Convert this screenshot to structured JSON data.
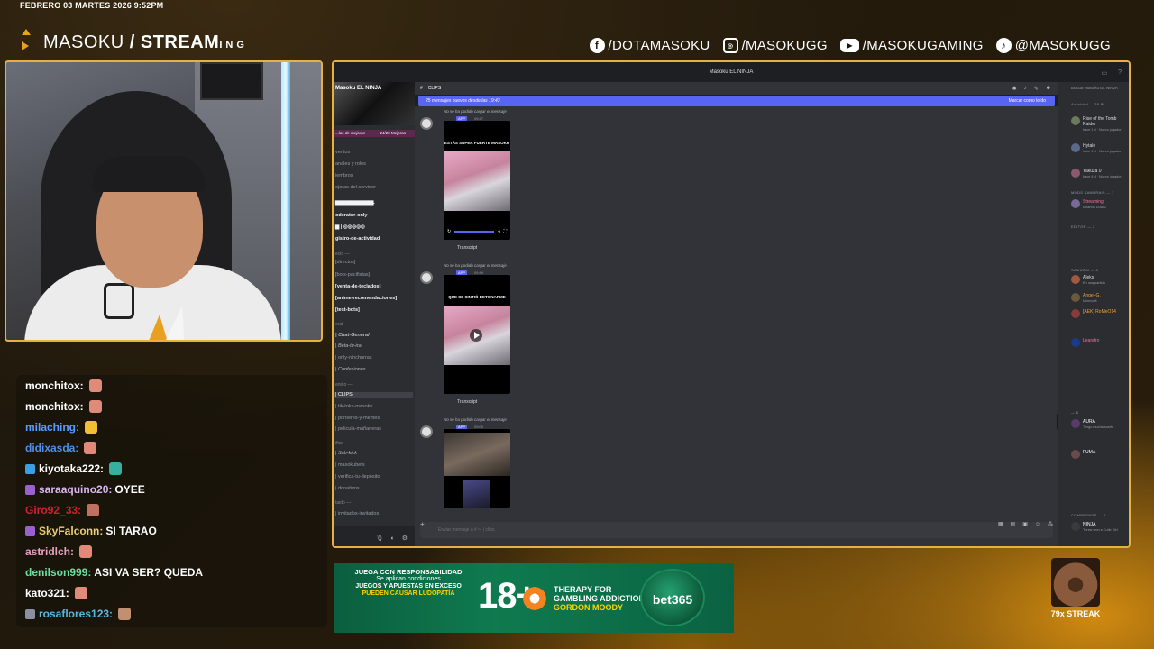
{
  "overlay": {
    "datetime": "FEBRERO 03 MARTES 2026 9:52PM",
    "logo_main": "MASOKU",
    "logo_slash": " / ",
    "logo_stream": "STREAM",
    "logo_small": "ING",
    "socials": [
      {
        "icon": "facebook-icon",
        "glyph": "f",
        "label": "/DOTAMASOKU"
      },
      {
        "icon": "instagram-icon",
        "glyph": "◎",
        "label": "/MASOKUGG"
      },
      {
        "icon": "youtube-icon",
        "glyph": "▶",
        "label": "/MASOKUGAMING"
      },
      {
        "icon": "tiktok-icon",
        "glyph": "♪",
        "label": "@MASOKUGG"
      }
    ],
    "accent": "#e8b040"
  },
  "chat": [
    {
      "user": "monchitox:",
      "color": "#ffffff",
      "msg": "",
      "emote": "#e08a7a",
      "badge": ""
    },
    {
      "user": "monchitox:",
      "color": "#ffffff",
      "msg": "",
      "emote": "#e08a7a",
      "badge": ""
    },
    {
      "user": "milaching:",
      "color": "#5b9bff",
      "msg": "",
      "emote": "#f0c030",
      "badge": ""
    },
    {
      "user": "didixasda:",
      "color": "#4f8fe8",
      "msg": "",
      "emote": "#e08a7a",
      "badge": ""
    },
    {
      "user": "kiyotaka222:",
      "color": "#ffffff",
      "msg": "",
      "emote": "#38b0a0",
      "badge": "#3aa0e0"
    },
    {
      "user": "saraaquino20:",
      "color": "#d9b8f0",
      "msg": "OYEE",
      "emote": "",
      "badge": "#9a60d0"
    },
    {
      "user": "Giro92_33:",
      "color": "#d02030",
      "msg": "",
      "emote": "#c07060",
      "badge": ""
    },
    {
      "user": "SkyFalconn:",
      "color": "#e8d070",
      "msg": "SI TARAO",
      "emote": "",
      "badge": "#9a60d0"
    },
    {
      "user": "astridlch:",
      "color": "#e8a0c0",
      "msg": "",
      "emote": "#e08a7a",
      "badge": ""
    },
    {
      "user": "denilson999:",
      "color": "#6ae0a0",
      "msg": "ASI VA SER? QUEDA",
      "emote": "",
      "badge": ""
    },
    {
      "user": "kato321:",
      "color": "#ffffff",
      "msg": "",
      "emote": "#e08a7a",
      "badge": ""
    },
    {
      "user": "rosaflores123:",
      "color": "#5ab8e0",
      "msg": "",
      "emote": "#c09070",
      "badge": "#8a90a0"
    }
  ],
  "discord": {
    "window_title": "Masoku EL NINJA",
    "server_name": "Masoku EL NINJA",
    "boost_left": "...las de mejoras",
    "boost_right": "24/20 Mejoras",
    "channels": [
      {
        "label": "ventos",
        "cls": ""
      },
      {
        "label": "anales y roles",
        "cls": ""
      },
      {
        "label": "iembros",
        "cls": ""
      },
      {
        "label": "ejoras del servidor",
        "cls": ""
      },
      {
        "label": "▆▆▆▆▆▆▆▆▆▆.",
        "cls": "bold"
      },
      {
        "label": "oderator-only",
        "cls": "bold"
      },
      {
        "label": "▆ | ◎◎◎◎◎",
        "cls": "bold"
      },
      {
        "label": "gistro-de-actividad",
        "cls": "bold"
      },
      {
        "label": "ecio —",
        "cls": "cat"
      },
      {
        "label": "[directos]",
        "cls": ""
      },
      {
        "label": "[bots-pacifistas]",
        "cls": ""
      },
      {
        "label": "[venta-de-teclados]",
        "cls": "bold"
      },
      {
        "label": "[anime-recomendaciones]",
        "cls": "bold"
      },
      {
        "label": "[test-bots]",
        "cls": "bold"
      },
      {
        "label": "eral —",
        "cls": "cat"
      },
      {
        "label": "| Chat-General",
        "cls": "bold ital"
      },
      {
        "label": "| Beta-tu-ira",
        "cls": "ital"
      },
      {
        "label": "| only-ninchurras",
        "cls": ""
      },
      {
        "label": "| Confesiones",
        "cls": "ital"
      },
      {
        "label": "enido —",
        "cls": "cat"
      },
      {
        "label": "| CLIPS",
        "cls": "active"
      },
      {
        "label": "| tik-toks-masoku",
        "cls": ""
      },
      {
        "label": "| poroeres-y-memes",
        "cls": ""
      },
      {
        "label": "| pelicula-mañaneras",
        "cls": ""
      },
      {
        "label": "ifica —",
        "cls": "cat"
      },
      {
        "label": "| Sub-kick",
        "cls": "ital"
      },
      {
        "label": "| masokubets",
        "cls": ""
      },
      {
        "label": "| verifica-tu-deposito",
        "cls": ""
      },
      {
        "label": "| donativos",
        "cls": ""
      },
      {
        "label": "taido —",
        "cls": "cat"
      },
      {
        "label": "| invitados-invitados",
        "cls": ""
      }
    ],
    "channel_header": "CLIPS",
    "new_messages": "25 mensajes nuevos desde las 19:43",
    "mark_read": "Marcar como leído",
    "messages": [
      {
        "reply": "No se ha podido cargar el mensaje",
        "app": "APP",
        "time": "09:47",
        "video_title": "ESTÁS SUPER FUERTE MASOKU",
        "transcript": "Transcript"
      },
      {
        "reply": "No se ha podido cargar el mensaje",
        "app": "APP",
        "time": "09:49",
        "video_title": "QUE SE SINTIÓ DETONARME",
        "transcript": "Transcript"
      },
      {
        "reply": "No se ha podido cargar el mensaje",
        "app": "APP",
        "time": "09:09",
        "video_title": "",
        "transcript": ""
      }
    ],
    "composer_placeholder": "Enviar mensaje a #  ✂ | clips",
    "member_search": "Buscar Masoku EL NINJA",
    "activity_label": "Actividad — 28 ⊕",
    "members": [
      {
        "name": "Rise of the Tomb Raider",
        "sub": "hace 1 d · Nuevo jugador",
        "color": "#dbdee1",
        "av": "#6a7a5a"
      },
      {
        "name": "Hytale",
        "sub": "hace 1 d · Nuevo jugador",
        "color": "#dbdee1",
        "av": "#5a6a8a"
      },
      {
        "name": "Yakuza 0",
        "sub": "hace 4 d · Nuevo jugador",
        "color": "#dbdee1",
        "av": "#8a5a6a"
      },
      {
        "name": "Streaming",
        "sub": "Mirando Dota 2",
        "color": "#ff6b9a",
        "av": "#7a6a9a"
      },
      {
        "name": "Aleks",
        "sub": "En una partida",
        "color": "#dbdee1",
        "av": "#a05a40"
      },
      {
        "name": "Angel-G.",
        "sub": "Minecraft",
        "color": "#f0a040",
        "av": "#6a5a3a"
      },
      {
        "name": "[AEK] RoMeO14",
        "sub": "",
        "color": "#f0a040",
        "av": "#8a3a3a"
      },
      {
        "name": "Leandro",
        "sub": "",
        "color": "#ff6b9a",
        "av": "#1a3a8a"
      },
      {
        "name": "AURA",
        "sub": "Tengo mucha suerte",
        "color": "#ffffff",
        "av": "#5a3a6a"
      },
      {
        "name": "FUMA",
        "sub": "",
        "color": "#ffffff",
        "av": "#6a4a4a"
      },
      {
        "name": "NINJA",
        "sub": "Threw won a Cutie Girl",
        "color": "#ffffff",
        "av": "#3a3a3a"
      }
    ],
    "member_cats": [
      "MODS SAMURAIS — 1",
      "EDITOR — 2",
      "SAMURAI — 6",
      "— 6",
      "COMPRENDE — 4"
    ]
  },
  "bet": {
    "l1": "JUEGA CON RESPONSABILIDAD",
    "l2": "Se aplican condiciones",
    "l3": "JUEGOS Y APUESTAS EN EXCESO",
    "l4": "PUEDEN CAUSAR LUDOPATÍA",
    "age": "18+",
    "therapy": "THERAPY FOR",
    "gambling": "GAMBLING ADDICTION",
    "gordon": "GORDON MOODY",
    "brand": "bet365"
  },
  "streak": {
    "label": "79x STREAK"
  }
}
